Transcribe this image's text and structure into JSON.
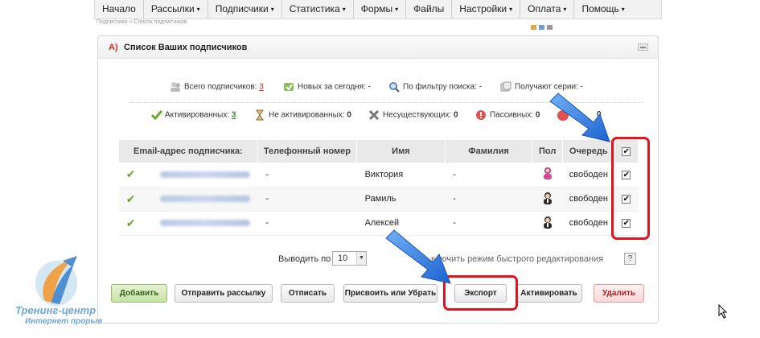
{
  "topnav": {
    "items": [
      {
        "label": "Начало",
        "dropdown": false
      },
      {
        "label": "Рассылки",
        "dropdown": true
      },
      {
        "label": "Подписчики",
        "dropdown": true
      },
      {
        "label": "Статистика",
        "dropdown": true
      },
      {
        "label": "Формы",
        "dropdown": true
      },
      {
        "label": "Файлы",
        "dropdown": false
      },
      {
        "label": "Настройки",
        "dropdown": true
      },
      {
        "label": "Оплата",
        "dropdown": true
      },
      {
        "label": "Помощь",
        "dropdown": true
      }
    ],
    "caret": "▾"
  },
  "breadcrumb": "Подписчики  »  Список подписчиков",
  "panel": {
    "letter": "A)",
    "title": "Список Ваших подписчиков"
  },
  "stats": {
    "total_label": "Всего подписчиков:",
    "total_value": "3",
    "new_today_label": "Новых за сегодня:",
    "new_today_value": "-",
    "by_filter_label": "По фильтру поиска:",
    "by_filter_value": "-",
    "series_label": "Получают серии:",
    "series_value": "-",
    "activated_label": "Активированных:",
    "activated_value": "3",
    "not_activated_label": "Не активированных:",
    "not_activated_value": "0",
    "nonexistent_label": "Несуществующих:",
    "nonexistent_value": "0",
    "passive_label": "Пассивных:",
    "passive_value": "0",
    "hidden_value": "0"
  },
  "table": {
    "headers": {
      "email": "Email-адрес подписчика:",
      "phone": "Телефонный номер",
      "name": "Имя",
      "surname": "Фамилия",
      "sex": "Пол",
      "queue": "Очередь"
    },
    "rows": [
      {
        "phone": "-",
        "name": "Виктория",
        "surname": "-",
        "sex": "female",
        "queue": "свободен",
        "checked": true
      },
      {
        "phone": "-",
        "name": "Рамиль",
        "surname": "-",
        "sex": "male",
        "queue": "свободен",
        "checked": true
      },
      {
        "phone": "-",
        "name": "Алексей",
        "surname": "-",
        "sex": "male",
        "queue": "свободен",
        "checked": true
      }
    ],
    "check_mark": "✔",
    "box_mark": "✔"
  },
  "pager": {
    "per_page_label": "Выводить по",
    "per_page_value": "10",
    "quick_edit_label": "ключить режим быстрого редактирования",
    "help_label": "?"
  },
  "buttons": {
    "add": "Добавить",
    "send": "Отправить рассылку",
    "unsubscribe": "Отписать",
    "assign": "Присвоить или Убрать",
    "export": "Экспорт",
    "activate": "Активировать",
    "delete": "Удалить"
  },
  "logo": {
    "line1": "Тренинг-центр",
    "line2": "Интернет прорыв"
  },
  "colors": {
    "highlight": "#e0141e",
    "arrow": "#2f7fe0",
    "accent_red": "#d62a2a",
    "green": "#6aa82a"
  }
}
